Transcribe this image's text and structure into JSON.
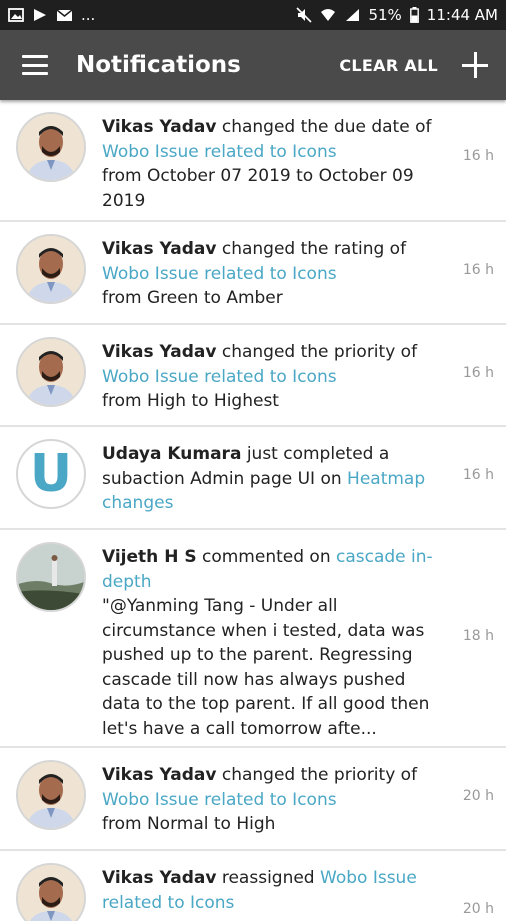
{
  "status_bar": {
    "left_icons": [
      "image-icon",
      "play-icon",
      "mail-icon"
    ],
    "more": "...",
    "battery": "51%",
    "time": "11:44 AM"
  },
  "app_bar": {
    "title": "Notifications",
    "clear_all": "CLEAR ALL"
  },
  "notifications": [
    {
      "user": "Vikas Yadav",
      "action": " changed the due date of ",
      "link": "Wobo Issue related to Icons",
      "detail": "from October 07 2019 to October 09 2019",
      "time": "16 h"
    },
    {
      "user": "Vikas Yadav",
      "action": " changed the rating of ",
      "link": "Wobo Issue related to Icons",
      "detail": "from Green to Amber",
      "time": "16 h"
    },
    {
      "user": "Vikas Yadav",
      "action": " changed the priority of ",
      "link": "Wobo Issue related to Icons",
      "detail": "from High to Highest",
      "time": "16 h"
    },
    {
      "user": "Udaya Kumara",
      "action": " just completed a subaction Admin page UI on ",
      "link": "Heatmap changes",
      "detail": "",
      "time": "16 h",
      "avatar_letter": "U"
    },
    {
      "user": "Vijeth H S",
      "action": " commented on ",
      "link": "cascade in-depth",
      "detail": "\"@Yanming Tang - Under all circumstance when i tested, data was pushed up to the parent. Regressing cascade till now has always pushed data to the top parent. If all good then let's have a call tomorrow afte...",
      "time": "18 h"
    },
    {
      "user": "Vikas Yadav",
      "action": " changed the priority of ",
      "link": "Wobo Issue related to Icons",
      "detail": "from Normal to High",
      "time": "20 h"
    },
    {
      "user": "Vikas Yadav",
      "action": " reassigned ",
      "link": "Wobo Issue related to Icons",
      "detail": "",
      "time": "20 h"
    }
  ],
  "colors": {
    "app_bar": "#4a4a4a",
    "link": "#4aa7c5"
  }
}
